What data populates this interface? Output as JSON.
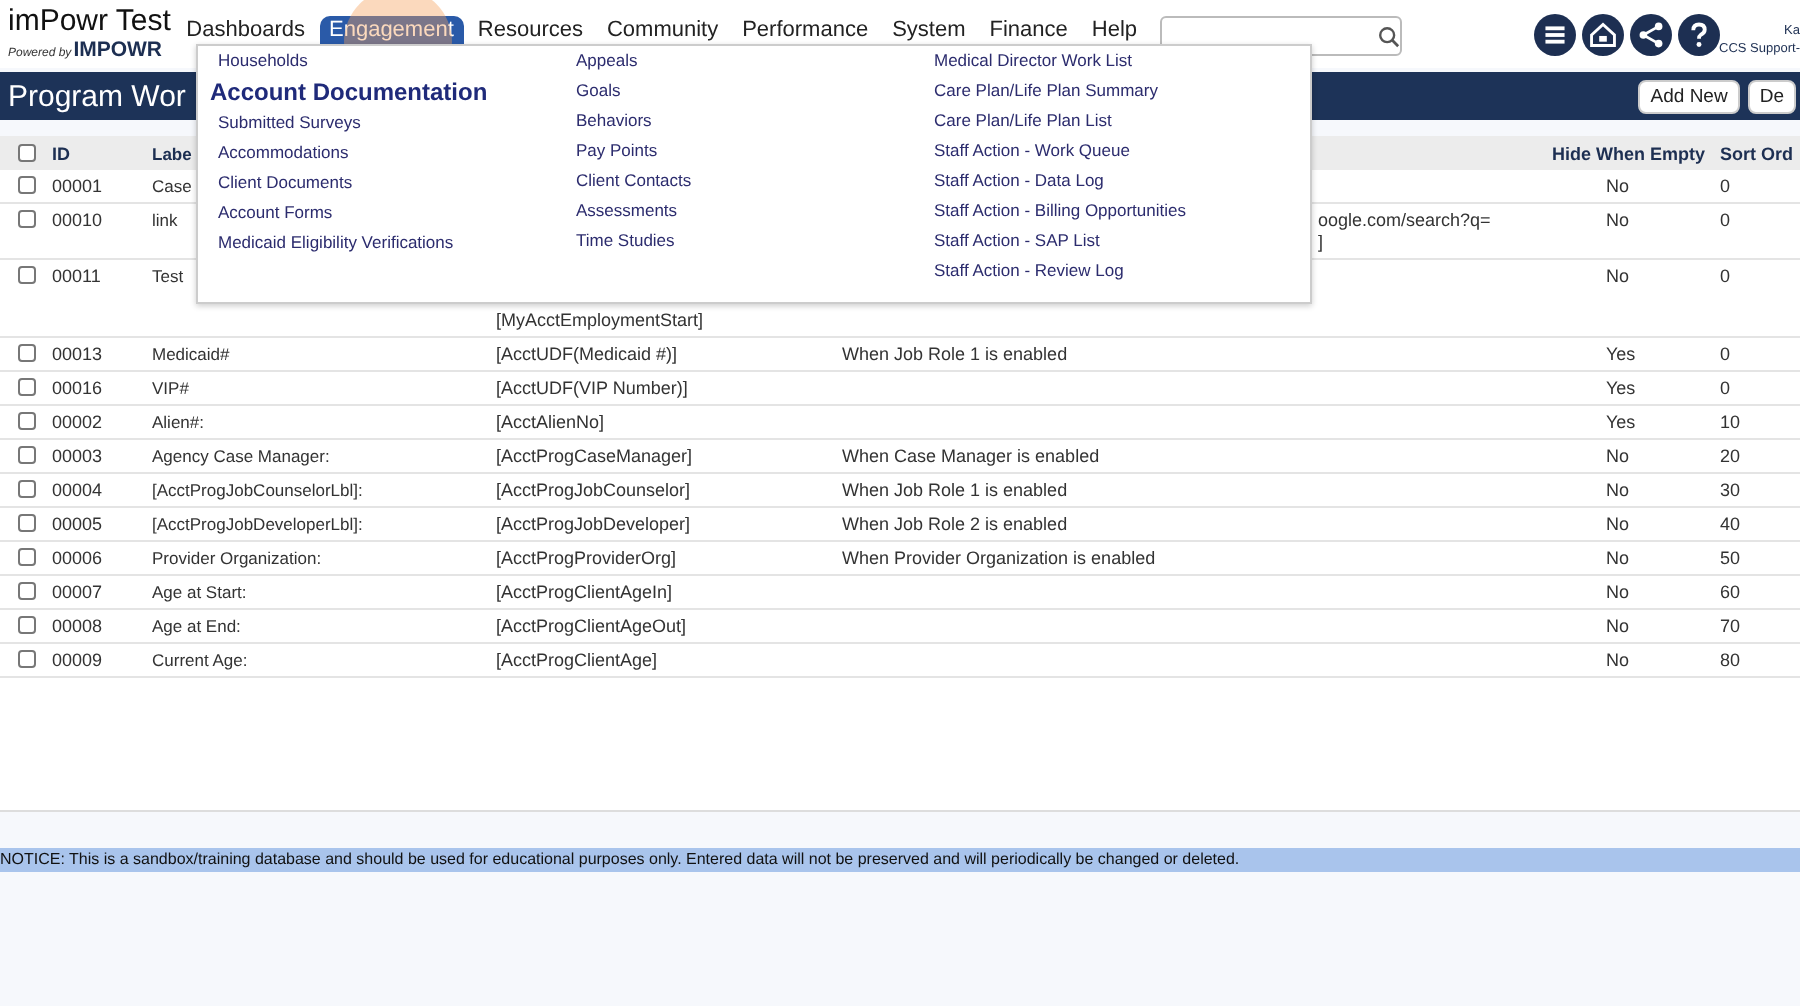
{
  "header": {
    "logo_title": "imPowr Test",
    "powered_by": "Powered by",
    "brand": "IMPOWR",
    "nav": [
      {
        "label": "Dashboards",
        "selected": false
      },
      {
        "label": "Engagement",
        "selected": true
      },
      {
        "label": "Resources",
        "selected": false
      },
      {
        "label": "Community",
        "selected": false
      },
      {
        "label": "Performance",
        "selected": false
      },
      {
        "label": "System",
        "selected": false
      },
      {
        "label": "Finance",
        "selected": false
      },
      {
        "label": "Help",
        "selected": false
      }
    ],
    "user": {
      "name": "Ka",
      "role": "CCS Support-"
    }
  },
  "page_title": "Program Wor",
  "buttons": [
    "Add New",
    "De"
  ],
  "menu": {
    "columns": [
      [
        {
          "kind": "link",
          "label": "Households"
        },
        {
          "kind": "heading",
          "label": "Account Documentation"
        },
        {
          "kind": "link",
          "label": "Submitted Surveys"
        },
        {
          "kind": "link",
          "label": "Accommodations"
        },
        {
          "kind": "link",
          "label": "Client Documents"
        },
        {
          "kind": "link",
          "label": "Account Forms"
        },
        {
          "kind": "link",
          "label": "Medicaid Eligibility Verifications"
        }
      ],
      [
        {
          "kind": "link",
          "label": "Appeals"
        },
        {
          "kind": "link",
          "label": "Goals"
        },
        {
          "kind": "link",
          "label": "Behaviors"
        },
        {
          "kind": "link",
          "label": "Pay Points"
        },
        {
          "kind": "link",
          "label": "Client Contacts"
        },
        {
          "kind": "link",
          "label": "Assessments"
        },
        {
          "kind": "link",
          "label": "Time Studies"
        }
      ],
      [
        {
          "kind": "link",
          "label": "Medical Director Work List"
        },
        {
          "kind": "link",
          "label": "Care Plan/Life Plan Summary"
        },
        {
          "kind": "link",
          "label": "Care Plan/Life Plan List"
        },
        {
          "kind": "link",
          "label": "Staff Action - Work Queue"
        },
        {
          "kind": "link",
          "label": "Staff Action - Data Log"
        },
        {
          "kind": "link",
          "label": "Staff Action - Billing Opportunities"
        },
        {
          "kind": "link",
          "label": "Staff Action - SAP List"
        },
        {
          "kind": "link",
          "label": "Staff Action - Review Log"
        }
      ]
    ]
  },
  "table": {
    "select_all_checked": false,
    "columns": {
      "id": "ID",
      "label": "Labe",
      "hide": "Hide When Empty",
      "sort": "Sort Ord"
    },
    "rows": [
      {
        "kind": "plain",
        "checked": false,
        "id": "00001",
        "label": "Case",
        "hide": "No",
        "sort": "0"
      },
      {
        "kind": "covered",
        "checked": false,
        "id": "00010",
        "label": "link",
        "column_4": [
          "oogle.com/search?q=",
          "]"
        ],
        "hide": "No",
        "sort": "0"
      },
      {
        "kind": "covered",
        "checked": false,
        "id": "00011",
        "label": "Test",
        "column_3": [
          "[MyAcctEmploymentStart]"
        ],
        "hide": "No",
        "sort": "0"
      },
      {
        "kind": "plain",
        "checked": false,
        "id": "00013",
        "label": "Medicaid#",
        "column_3": [
          "[AcctUDF(Medicaid #)]"
        ],
        "column_4": [
          "When Job Role 1 is enabled"
        ],
        "hide": "Yes",
        "sort": "0"
      },
      {
        "kind": "plain",
        "checked": false,
        "id": "00016",
        "label": "VIP#",
        "column_3": [
          "[AcctUDF(VIP Number)]"
        ],
        "hide": "Yes",
        "sort": "0"
      },
      {
        "kind": "plain",
        "checked": false,
        "id": "00002",
        "label": "Alien#:",
        "column_3": [
          "[AcctAlienNo]"
        ],
        "hide": "Yes",
        "sort": "10"
      },
      {
        "kind": "plain",
        "checked": false,
        "id": "00003",
        "label": "Agency Case Manager:",
        "column_3": [
          "[AcctProgCaseManager]"
        ],
        "column_4": [
          "When Case Manager is enabled"
        ],
        "hide": "No",
        "sort": "20"
      },
      {
        "kind": "plain",
        "checked": false,
        "id": "00004",
        "label": "[AcctProgJobCounselorLbl]:",
        "column_3": [
          "[AcctProgJobCounselor]"
        ],
        "column_4": [
          "When Job Role 1 is enabled"
        ],
        "hide": "No",
        "sort": "30"
      },
      {
        "kind": "plain",
        "checked": false,
        "id": "00005",
        "label": "[AcctProgJobDeveloperLbl]:",
        "column_3": [
          "[AcctProgJobDeveloper]"
        ],
        "column_4": [
          "When Job Role 2 is enabled"
        ],
        "hide": "No",
        "sort": "40"
      },
      {
        "kind": "plain",
        "checked": false,
        "id": "00006",
        "label": "Provider Organization:",
        "column_3": [
          "[AcctProgProviderOrg]"
        ],
        "column_4": [
          "When Provider Organization is enabled"
        ],
        "hide": "No",
        "sort": "50"
      },
      {
        "kind": "plain",
        "checked": false,
        "id": "00007",
        "label": "Age at Start:",
        "column_3": [
          "[AcctProgClientAgeIn]"
        ],
        "hide": "No",
        "sort": "60"
      },
      {
        "kind": "plain",
        "checked": false,
        "id": "00008",
        "label": "Age at End:",
        "column_3": [
          "[AcctProgClientAgeOut]"
        ],
        "hide": "No",
        "sort": "70"
      },
      {
        "kind": "plain",
        "checked": false,
        "id": "00009",
        "label": "Current Age:",
        "column_3": [
          "[AcctProgClientAge]"
        ],
        "hide": "No",
        "sort": "80"
      }
    ]
  },
  "notice": "NOTICE: This is a sandbox/training database and should be used for educational purposes only. Entered data will not be preserved and will periodically be changed or deleted."
}
